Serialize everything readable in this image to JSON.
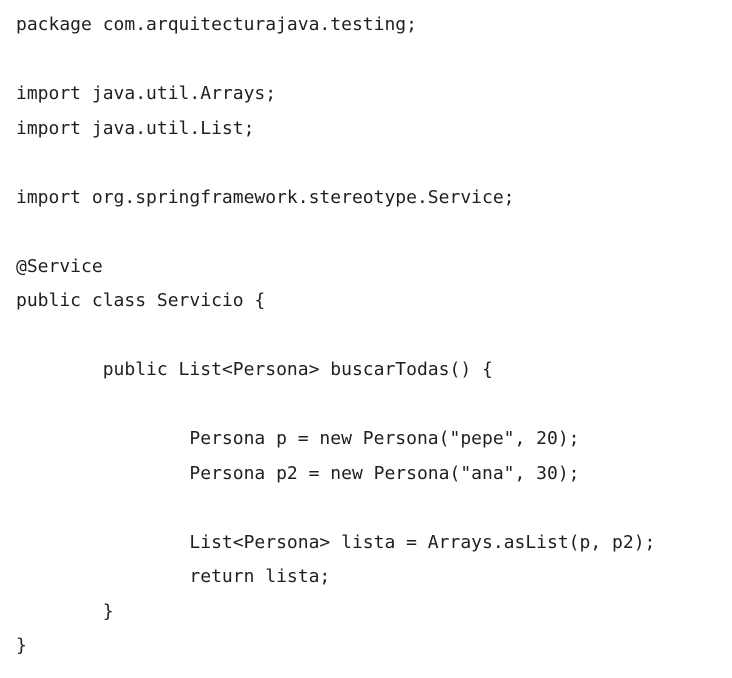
{
  "code": {
    "lines": [
      "package com.arquitecturajava.testing;",
      "",
      "import java.util.Arrays;",
      "import java.util.List;",
      "",
      "import org.springframework.stereotype.Service;",
      "",
      "@Service",
      "public class Servicio {",
      "",
      "        public List<Persona> buscarTodas() {",
      "",
      "                Persona p = new Persona(\"pepe\", 20);",
      "                Persona p2 = new Persona(\"ana\", 30);",
      "",
      "                List<Persona> lista = Arrays.asList(p, p2);",
      "                return lista;",
      "        }",
      "}"
    ]
  }
}
